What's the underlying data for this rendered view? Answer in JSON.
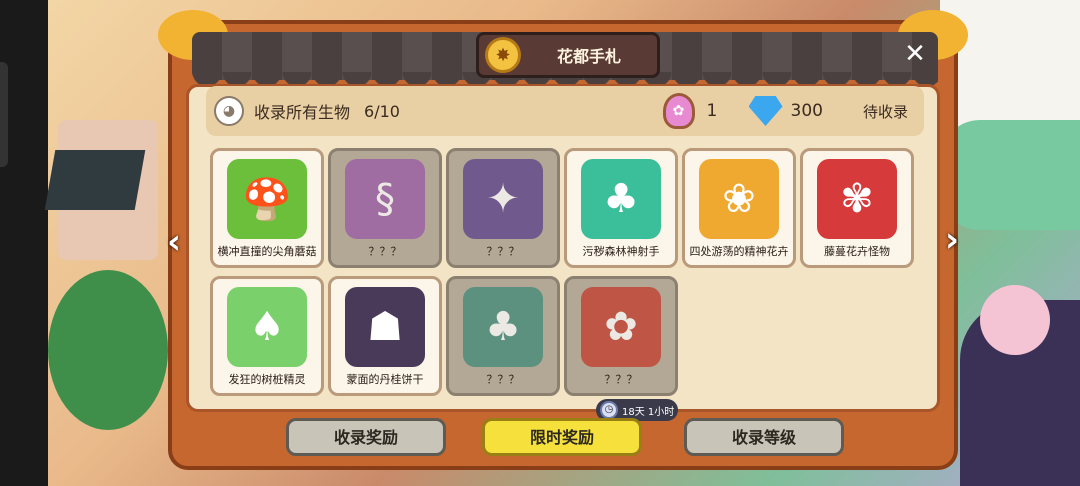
{
  "window": {
    "title": "花都手札",
    "close_symbol": "✕"
  },
  "info": {
    "collect_label": "收录所有生物",
    "collect_count": "6/10",
    "potion_count": "1",
    "gem_count": "300",
    "pending_label": "待收录"
  },
  "cards": [
    {
      "label": "横冲直撞的尖角蘑菇",
      "locked": false,
      "art_color": "#6bbf3a",
      "icon": "mushroom-monster-icon"
    },
    {
      "label": "？？？",
      "locked": true,
      "art_color": "#9a5aa8",
      "icon": "vine-snake-icon"
    },
    {
      "label": "？？？",
      "locked": true,
      "art_color": "#5a3f8a",
      "icon": "dark-plant-icon"
    },
    {
      "label": "污秽森林神射手",
      "locked": false,
      "art_color": "#3bbf9a",
      "icon": "forest-archer-icon"
    },
    {
      "label": "四处游荡的精神花卉",
      "locked": false,
      "art_color": "#f0a930",
      "icon": "wandering-flower-icon"
    },
    {
      "label": "藤蔓花卉怪物",
      "locked": false,
      "art_color": "#d63a3a",
      "icon": "vine-flower-monster-icon"
    },
    {
      "label": "发狂的树桩精灵",
      "locked": false,
      "art_color": "#7ad06a",
      "icon": "stump-spirit-icon"
    },
    {
      "label": "蒙面的丹桂饼干",
      "locked": false,
      "art_color": "#4a3a5a",
      "icon": "masked-cookie-icon"
    },
    {
      "label": "？？？",
      "locked": true,
      "art_color": "#3f8a78",
      "icon": "tree-spirit-icon"
    },
    {
      "label": "？？？",
      "locked": true,
      "art_color": "#c33a2a",
      "icon": "red-flower-icon"
    }
  ],
  "timer": {
    "text": "18天 1小时"
  },
  "buttons": {
    "collect_reward": "收录奖励",
    "limited_reward": "限时奖励",
    "collect_level": "收录等级"
  },
  "colors": {
    "panel": "#c5672f",
    "active_button": "#f6e03b",
    "inactive_button": "#c9c4b8"
  }
}
